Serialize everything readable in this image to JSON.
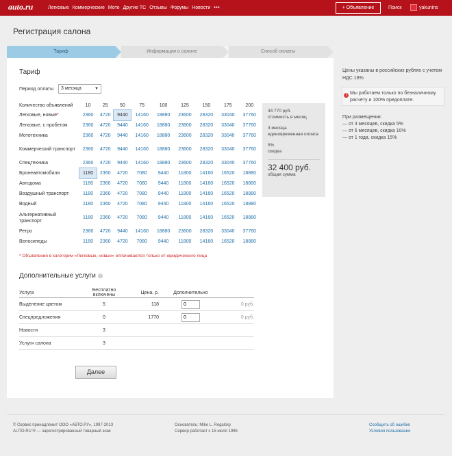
{
  "header": {
    "logo": "auto.ru",
    "nav": [
      "Легковые",
      "Коммерческие",
      "Мото",
      "Другие ТС",
      "Отзывы",
      "Форумы",
      "Новости"
    ],
    "more": "•••",
    "add_button": "+ Объявление",
    "search": "Поиск",
    "username": "yakunins"
  },
  "page_title": "Регистрация салона",
  "steps": [
    "Тариф",
    "Информация о салоне",
    "Способ оплаты"
  ],
  "tariff": {
    "title": "Тариф",
    "period_label": "Период оплаты",
    "period_value": "3 месяца",
    "columns": [
      "Количество объявлений",
      "10",
      "25",
      "50",
      "75",
      "100",
      "125",
      "150",
      "175",
      "200"
    ],
    "rows": [
      {
        "name": "Легковые, новые",
        "required": "*",
        "values": [
          "2360",
          "4720",
          "9440",
          "14160",
          "18880",
          "23600",
          "28320",
          "33040",
          "37760"
        ]
      },
      {
        "name": "Легковые, с пробегом",
        "values": [
          "2360",
          "4720",
          "9440",
          "14160",
          "18880",
          "23600",
          "28320",
          "33040",
          "37760"
        ]
      },
      {
        "name": "Мототехника",
        "values": [
          "2360",
          "4720",
          "9440",
          "14160",
          "18880",
          "23600",
          "28320",
          "33040",
          "37760"
        ]
      },
      {
        "name": "Коммерческий транспорт",
        "values": [
          "2360",
          "4720",
          "9440",
          "14160",
          "18880",
          "23600",
          "28320",
          "33040",
          "37760"
        ]
      },
      {
        "name": "Спецтехника",
        "values": [
          "2360",
          "4720",
          "9440",
          "14160",
          "18880",
          "23600",
          "28320",
          "33040",
          "37760"
        ]
      },
      {
        "name": "Бронеавтомобили",
        "values": [
          "1180",
          "2360",
          "4720",
          "7080",
          "9440",
          "11800",
          "14160",
          "16520",
          "18880"
        ]
      },
      {
        "name": "Автодома",
        "values": [
          "1180",
          "2360",
          "4720",
          "7080",
          "9440",
          "11800",
          "14160",
          "16520",
          "18880"
        ]
      },
      {
        "name": "Воздушный транспорт",
        "values": [
          "1180",
          "2360",
          "4720",
          "7080",
          "9440",
          "11800",
          "14160",
          "16520",
          "18880"
        ]
      },
      {
        "name": "Водный",
        "values": [
          "1180",
          "2360",
          "4720",
          "7080",
          "9440",
          "11800",
          "14160",
          "16520",
          "18880"
        ]
      },
      {
        "name": "Альтернативный транспорт",
        "values": [
          "1180",
          "2360",
          "4720",
          "7080",
          "9440",
          "11800",
          "14160",
          "16520",
          "18880"
        ]
      },
      {
        "name": "Ретро",
        "values": [
          "2360",
          "4720",
          "9440",
          "14160",
          "18880",
          "23600",
          "28320",
          "33040",
          "37760"
        ]
      },
      {
        "name": "Велосипеды",
        "values": [
          "1180",
          "2360",
          "4720",
          "7080",
          "9440",
          "11800",
          "14160",
          "16520",
          "18880"
        ]
      }
    ],
    "note": "* Объявления в категории «Легковые, новые» оплачиваются только от юридического лица"
  },
  "summary": {
    "cost_value": "34 770 руб.",
    "cost_label": "стоимость в месяц",
    "payment_value": "3 месяца",
    "payment_label": "единовременная оплата",
    "discount_value": "5%",
    "discount_label": "скидка",
    "total_value": "32 400 руб.",
    "total_label": "общая сумма"
  },
  "extra": {
    "title": "Дополнительные услуги",
    "help": "?",
    "headers": [
      "Услуга",
      "Бесплатно включены",
      "Цена, р.",
      "Дополнительно",
      ""
    ],
    "rows": [
      {
        "name": "Выделение цветом",
        "free": "5",
        "price": "118",
        "qty": "0",
        "sum": "0 руб."
      },
      {
        "name": "Спецпредложения",
        "free": "0",
        "price": "1770",
        "qty": "0",
        "sum": "0 руб."
      },
      {
        "name": "Новости",
        "free": "3",
        "price": "",
        "qty": "",
        "sum": ""
      },
      {
        "name": "Услуги салона",
        "free": "3",
        "price": "",
        "qty": "",
        "sum": ""
      }
    ]
  },
  "next_button": "Далее",
  "sidebar": {
    "prices_note": "Цены указаны в российских рублях с учетом НДС 18%",
    "alert_icon": "!",
    "alert": "Мы работаем только по безналичному расчёту и 100% предоплате.",
    "discounts_title": "При размещении:",
    "discounts": [
      "— от 3 месяцев, скидка 5%",
      "— от 6 месяцев, скидка 10%",
      "— от 1 года, скидка 15%"
    ]
  },
  "footer": {
    "copyright": "© Сервис принадлежит ООО «АВТО.РУ», 1997-2013",
    "trademark": "AUTO.RU ® — зарегистрированный товарный знак",
    "founder": "Основатель: Mike L. Rogalsky",
    "uptime": "Сервер работает с 15 июля 1996",
    "report_link": "Сообщить об ошибке",
    "terms_link": "Условия пользования"
  },
  "colors": {
    "brand_red": "#b5121b",
    "link_blue": "#1f6fa8",
    "active_step": "#9ccbe6"
  }
}
